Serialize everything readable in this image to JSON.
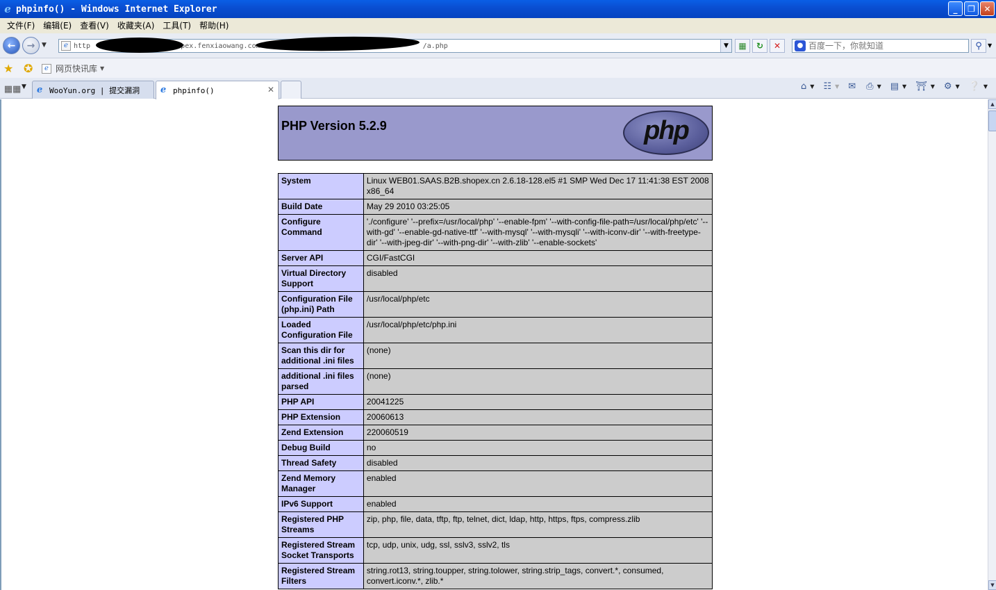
{
  "window": {
    "title": "phpinfo() - Windows Internet Explorer",
    "controls": {
      "minimize": "_",
      "maximize": "❐",
      "close": "✕"
    }
  },
  "menu": [
    "文件(F)",
    "编辑(E)",
    "查看(V)",
    "收藏夹(A)",
    "工具(T)",
    "帮助(H)"
  ],
  "address_bar": {
    "url_visible_parts": [
      "http",
      "shopex.fenxiaowang.com",
      "/a.php"
    ],
    "search_placeholder": "百度一下，你就知道"
  },
  "favorites_bar": {
    "link_label": "网页快讯库"
  },
  "tabs": [
    {
      "label": "WooYun.org | 提交漏洞",
      "active": false
    },
    {
      "label": "phpinfo()",
      "active": true
    }
  ],
  "icons": {
    "back": "back-arrow-icon",
    "forward": "forward-arrow-icon",
    "refresh": "refresh-icon",
    "stop": "stop-icon",
    "search": "search-icon",
    "home": "home-icon",
    "feeds": "rss-icon",
    "mail": "mail-icon",
    "print": "print-icon",
    "page": "page-icon",
    "safety": "safety-icon",
    "tools": "gear-icon",
    "help": "help-icon"
  },
  "php": {
    "version_title": "PHP Version 5.2.9",
    "logo_text": "php",
    "rows": [
      {
        "key": "System",
        "value": "Linux WEB01.SAAS.B2B.shopex.cn 2.6.18-128.el5 #1 SMP Wed Dec 17 11:41:38 EST 2008 x86_64"
      },
      {
        "key": "Build Date",
        "value": "May 29 2010 03:25:05"
      },
      {
        "key": "Configure Command",
        "value": "'./configure' '--prefix=/usr/local/php' '--enable-fpm' '--with-config-file-path=/usr/local/php/etc' '--with-gd' '--enable-gd-native-ttf' '--with-mysql' '--with-mysqli' '--with-iconv-dir' '--with-freetype-dir' '--with-jpeg-dir' '--with-png-dir' '--with-zlib' '--enable-sockets'"
      },
      {
        "key": "Server API",
        "value": "CGI/FastCGI"
      },
      {
        "key": "Virtual Directory Support",
        "value": "disabled"
      },
      {
        "key": "Configuration File (php.ini) Path",
        "value": "/usr/local/php/etc"
      },
      {
        "key": "Loaded Configuration File",
        "value": "/usr/local/php/etc/php.ini"
      },
      {
        "key": "Scan this dir for additional .ini files",
        "value": "(none)"
      },
      {
        "key": "additional .ini files parsed",
        "value": "(none)"
      },
      {
        "key": "PHP API",
        "value": "20041225"
      },
      {
        "key": "PHP Extension",
        "value": "20060613"
      },
      {
        "key": "Zend Extension",
        "value": "220060519"
      },
      {
        "key": "Debug Build",
        "value": "no"
      },
      {
        "key": "Thread Safety",
        "value": "disabled"
      },
      {
        "key": "Zend Memory Manager",
        "value": "enabled"
      },
      {
        "key": "IPv6 Support",
        "value": "enabled"
      },
      {
        "key": "Registered PHP Streams",
        "value": "zip, php, file, data, tftp, ftp, telnet, dict, ldap, http, https, ftps, compress.zlib"
      },
      {
        "key": "Registered Stream Socket Transports",
        "value": "tcp, udp, unix, udg, ssl, sslv3, sslv2, tls"
      },
      {
        "key": "Registered Stream Filters",
        "value": "string.rot13, string.toupper, string.tolower, string.strip_tags, convert.*, consumed, convert.iconv.*, zlib.*"
      }
    ]
  },
  "colors": {
    "titlebar": "#0a4fd2",
    "php_header": "#9999cc",
    "php_key_cell": "#ccccff",
    "php_value_cell": "#cccccc"
  }
}
